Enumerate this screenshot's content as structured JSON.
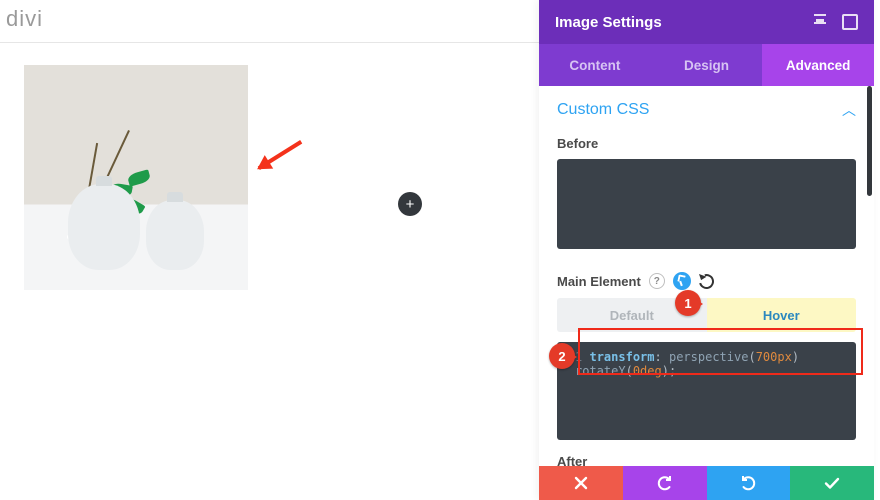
{
  "brand": "divi",
  "add_button_label": "+",
  "panel": {
    "title": "Image Settings",
    "tabs": [
      "Content",
      "Design",
      "Advanced"
    ],
    "active_tab_index": 2,
    "section": {
      "title": "Custom CSS",
      "fields": {
        "before_label": "Before",
        "before_value": "",
        "main_label": "Main Element",
        "state_default_label": "Default",
        "state_hover_label": "Hover",
        "main_line_number": "1",
        "main_tokens": {
          "prop": "transform",
          "colon": ":",
          "sp": " ",
          "func1": "perspective",
          "open1": "(",
          "val1": "700px",
          "close1": ")",
          "func2": "rotateY",
          "open2": "(",
          "val2": "0deg",
          "close2": ")",
          "semi": ";"
        },
        "after_label": "After"
      }
    }
  },
  "callouts": {
    "n1": "1",
    "n2": "2"
  }
}
